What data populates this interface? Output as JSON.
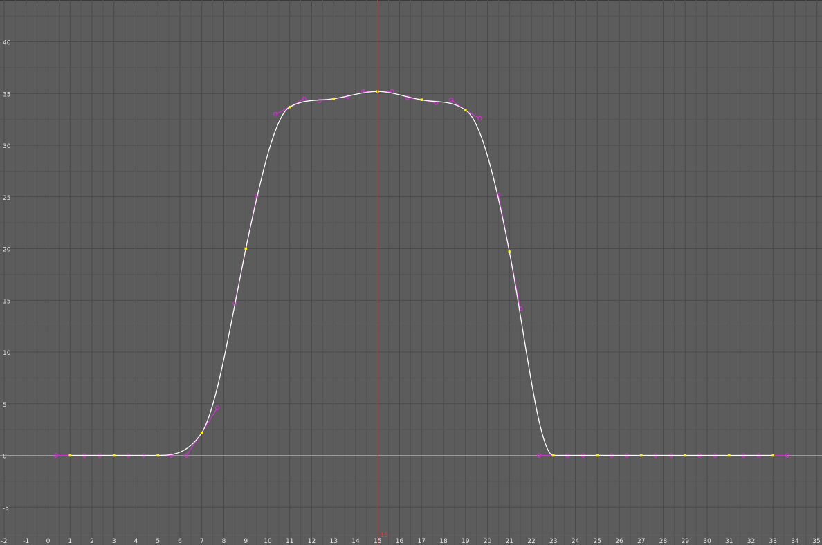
{
  "colors": {
    "background": "#5c5c5c",
    "grid_minor": "#535353",
    "grid_major": "#4a4a4a",
    "zero_line": "#9a9a9a",
    "curve": "#ffffff",
    "tangent": "#cc33cc",
    "key": "#ffee00",
    "playhead": "#ff2020"
  },
  "playhead": {
    "frame": 15,
    "label": "15"
  },
  "chart_data": {
    "type": "line",
    "xlim": [
      -2,
      35
    ],
    "ylim": [
      -8.5,
      44
    ],
    "x_ticks": [
      -2,
      -1,
      0,
      1,
      2,
      3,
      4,
      5,
      6,
      7,
      8,
      9,
      10,
      11,
      12,
      13,
      14,
      15,
      16,
      17,
      18,
      19,
      20,
      21,
      22,
      23,
      24,
      25,
      26,
      27,
      28,
      29,
      30,
      31,
      32,
      33,
      34,
      35
    ],
    "y_ticks": [
      -5,
      0,
      5,
      10,
      15,
      20,
      25,
      30,
      35,
      40
    ],
    "keys": [
      {
        "x": 1,
        "y": 0
      },
      {
        "x": 3,
        "y": 0
      },
      {
        "x": 5,
        "y": 0
      },
      {
        "x": 7,
        "y": 2.2
      },
      {
        "x": 9,
        "y": 20
      },
      {
        "x": 11,
        "y": 33.7
      },
      {
        "x": 13,
        "y": 34.5
      },
      {
        "x": 15,
        "y": 35.2
      },
      {
        "x": 17,
        "y": 34.4
      },
      {
        "x": 19,
        "y": 33.4
      },
      {
        "x": 21,
        "y": 19.7
      },
      {
        "x": 23,
        "y": 0
      },
      {
        "x": 25,
        "y": 0
      },
      {
        "x": 27,
        "y": 0
      },
      {
        "x": 29,
        "y": 0
      },
      {
        "x": 31,
        "y": 0
      },
      {
        "x": 33,
        "y": 0
      }
    ],
    "tangent_handles": [
      {
        "key": 1,
        "in": [
          0.35,
          0
        ],
        "out": [
          1.65,
          0
        ]
      },
      {
        "key": 3,
        "in": [
          2.35,
          0
        ],
        "out": [
          3.65,
          0
        ]
      },
      {
        "key": 5,
        "in": [
          4.35,
          0
        ],
        "out": [
          5.6,
          0
        ]
      },
      {
        "key": 7,
        "in": [
          6.3,
          0
        ],
        "out": [
          7.7,
          4.6
        ]
      },
      {
        "key": 9,
        "in": [
          8.5,
          14.7
        ],
        "out": [
          9.5,
          25.1
        ]
      },
      {
        "key": 11,
        "in": [
          10.35,
          33.0
        ],
        "out": [
          11.65,
          34.5
        ]
      },
      {
        "key": 13,
        "in": [
          12.35,
          34.3
        ],
        "out": [
          13.65,
          34.7
        ]
      },
      {
        "key": 15,
        "in": [
          14.35,
          35.2
        ],
        "out": [
          15.65,
          35.2
        ]
      },
      {
        "key": 17,
        "in": [
          16.35,
          34.6
        ],
        "out": [
          17.65,
          34.1
        ]
      },
      {
        "key": 19,
        "in": [
          18.35,
          34.4
        ],
        "out": [
          19.65,
          32.6
        ]
      },
      {
        "key": 21,
        "in": [
          20.5,
          25.2
        ],
        "out": [
          21.5,
          14.2
        ]
      },
      {
        "key": 23,
        "in": [
          22.35,
          0
        ],
        "out": [
          23.65,
          0
        ]
      },
      {
        "key": 25,
        "in": [
          24.35,
          0
        ],
        "out": [
          25.65,
          0
        ]
      },
      {
        "key": 27,
        "in": [
          26.35,
          0
        ],
        "out": [
          27.65,
          0
        ]
      },
      {
        "key": 29,
        "in": [
          28.35,
          0
        ],
        "out": [
          29.65,
          0
        ]
      },
      {
        "key": 31,
        "in": [
          30.35,
          0
        ],
        "out": [
          31.65,
          0
        ]
      },
      {
        "key": 33,
        "in": [
          32.35,
          0
        ],
        "out": [
          33.65,
          0
        ]
      }
    ],
    "grid": true
  }
}
